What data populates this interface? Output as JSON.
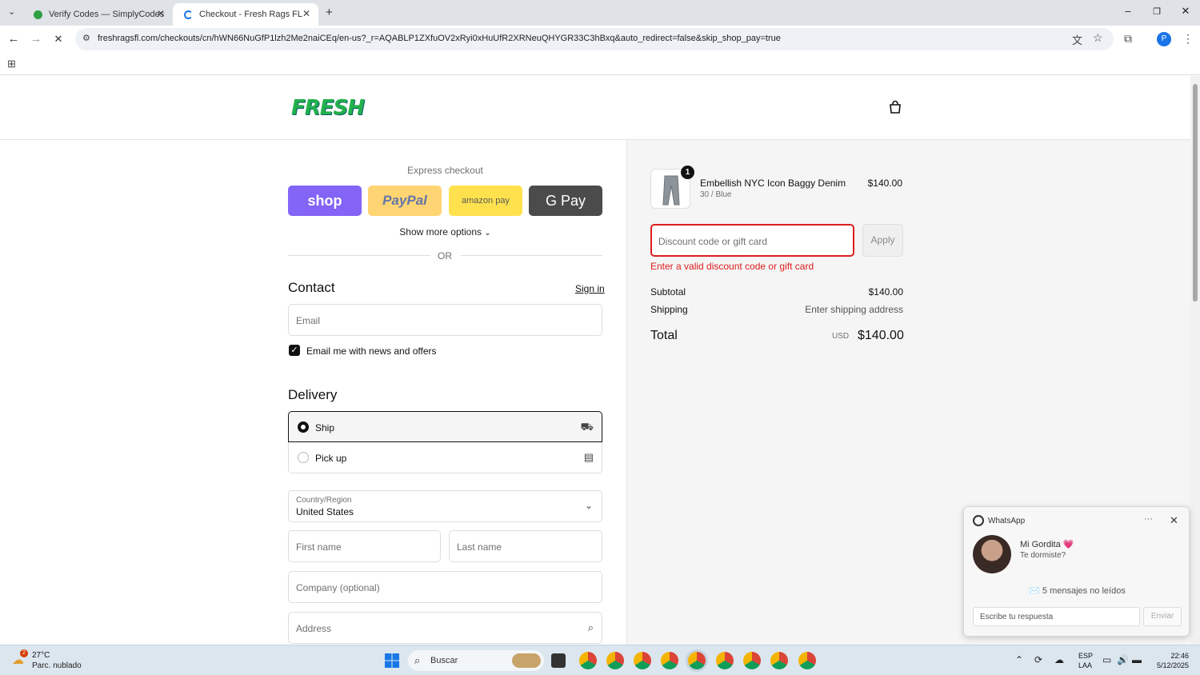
{
  "browser": {
    "tabs": [
      {
        "title": "Verify Codes — SimplyCodes",
        "favicon": "simplycodes-icon"
      },
      {
        "title": "Checkout - Fresh Rags FL",
        "favicon": "loading-spinner-icon"
      }
    ],
    "url": "freshragsfl.com/checkouts/cn/hWN66NuGfP1lzh2Me2naiCEq/en-us?_r=AQABLP1ZXfuOV2xRyi0xHuUfR2XRNeuQHYGR33C3hBxq&auto_redirect=false&skip_shop_pay=true",
    "profile_initial": "P",
    "accent": "#1a73e8"
  },
  "header": {
    "logo_text": "FRESH"
  },
  "express": {
    "title": "Express checkout",
    "shop_label": "shop",
    "paypal_label": "PayPal",
    "amazon_label": "amazon pay",
    "gpay_label": "G Pay",
    "more_options": "Show more options",
    "or": "OR"
  },
  "contact": {
    "title": "Contact",
    "sign_in": "Sign in",
    "email_placeholder": "Email",
    "newsletter_label": "Email me with news and offers",
    "newsletter_checked": true
  },
  "delivery": {
    "title": "Delivery",
    "options": [
      {
        "label": "Ship",
        "selected": true,
        "icon": "truck-icon"
      },
      {
        "label": "Pick up",
        "selected": false,
        "icon": "store-icon"
      }
    ],
    "country_label": "Country/Region",
    "country_value": "United States",
    "first_name_placeholder": "First name",
    "last_name_placeholder": "Last name",
    "company_placeholder": "Company (optional)",
    "address_placeholder": "Address"
  },
  "summary": {
    "product": {
      "name": "Embellish NYC Icon Baggy Denim",
      "variant": "30 / Blue",
      "price": "$140.00",
      "quantity": "1"
    },
    "discount_placeholder": "Discount code or gift card",
    "apply_label": "Apply",
    "discount_error": "Enter a valid discount code or gift card",
    "subtotal_label": "Subtotal",
    "subtotal_value": "$140.00",
    "shipping_label": "Shipping",
    "shipping_value": "Enter shipping address",
    "total_label": "Total",
    "total_currency": "USD",
    "total_value": "$140.00",
    "error_color": "#dd1d1d"
  },
  "whatsapp": {
    "title": "WhatsApp",
    "sender": "Mi Gordita 💗",
    "message": "Te dormiste?",
    "unread": "✉️ 5 mensajes no leídos",
    "reply_placeholder": "Escribe tu respuesta",
    "send_label": "Enviar"
  },
  "taskbar": {
    "weather_temp": "27°C",
    "weather_desc": "Parc. nublado",
    "weather_badge": "2",
    "search_label": "Buscar",
    "lang_line1": "ESP",
    "lang_line2": "LAA",
    "time": "22:46",
    "date": "5/12/2025"
  }
}
